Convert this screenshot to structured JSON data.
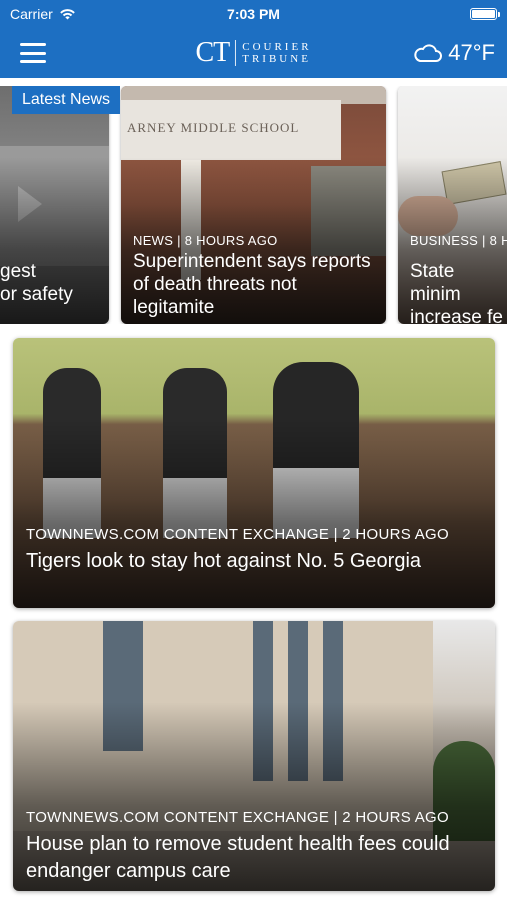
{
  "status_bar": {
    "carrier": "Carrier",
    "time": "7:03 PM"
  },
  "nav": {
    "logo_mark": "CT",
    "logo_line1": "COURIER",
    "logo_line2": "TRIBUNE",
    "temperature": "47°F"
  },
  "section": {
    "label": "Latest News"
  },
  "carousel": [
    {
      "meta": "",
      "title": "gest\nor safety"
    },
    {
      "meta": "NEWS | 8 HOURS AGO",
      "title": "Superintendent says reports of death threats not legitamite",
      "sign_text": "ARNEY MIDDLE SCHOOL"
    },
    {
      "meta": "BUSINESS | 8 H",
      "title": "State minim\nincrease fe"
    }
  ],
  "stories": [
    {
      "meta": "TOWNNEWS.COM CONTENT EXCHANGE | 2 HOURS AGO",
      "title": "Tigers look to stay hot against No. 5 Georgia"
    },
    {
      "meta": "TOWNNEWS.COM CONTENT EXCHANGE | 2 HOURS AGO",
      "title": "House plan to remove student health fees could endanger campus care"
    }
  ],
  "icons": {
    "menu": "hamburger-menu-icon",
    "weather": "cloud-icon",
    "wifi": "wifi-icon",
    "battery": "battery-icon"
  },
  "colors": {
    "brand_blue": "#1d6fc2"
  }
}
